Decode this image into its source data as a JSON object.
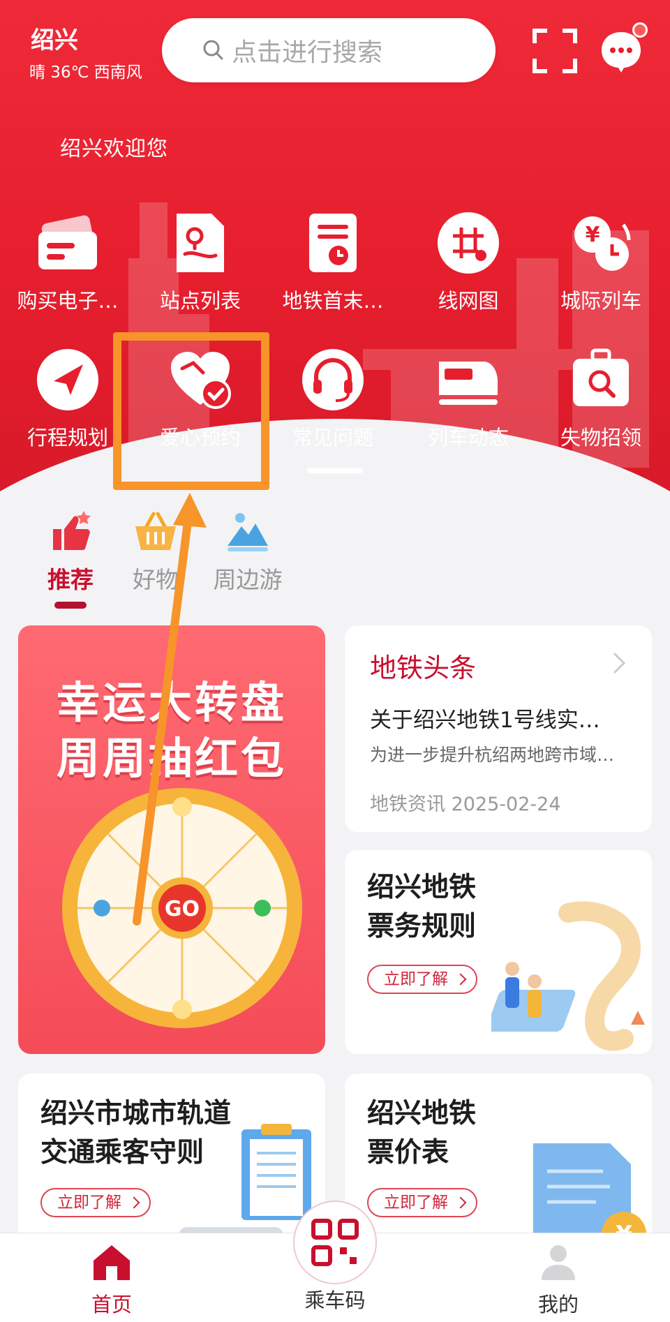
{
  "header": {
    "city": "绍兴",
    "weather": "晴 36℃ 西南风",
    "search_placeholder": "点击进行搜索",
    "welcome": "绍兴欢迎您"
  },
  "services": [
    {
      "label": "购买电子…",
      "icon": "ticket-card-icon"
    },
    {
      "label": "站点列表",
      "icon": "station-list-icon"
    },
    {
      "label": "地铁首末…",
      "icon": "first-last-train-icon"
    },
    {
      "label": "线网图",
      "icon": "network-map-icon"
    },
    {
      "label": "城际列车",
      "icon": "intercity-train-icon"
    },
    {
      "label": "行程规划",
      "icon": "route-plan-icon"
    },
    {
      "label": "爱心预约",
      "icon": "love-reservation-icon"
    },
    {
      "label": "常见问题",
      "icon": "faq-headset-icon"
    },
    {
      "label": "列车动态",
      "icon": "train-status-icon"
    },
    {
      "label": "失物招领",
      "icon": "lost-found-icon"
    }
  ],
  "tabs": [
    {
      "label": "推荐",
      "active": true
    },
    {
      "label": "好物",
      "active": false
    },
    {
      "label": "周边游",
      "active": false
    }
  ],
  "promo": {
    "line1": "幸运大转盘",
    "line2": "周周抽红包",
    "go": "GO"
  },
  "news": {
    "header": "地铁头条",
    "title": "关于绍兴地铁1号线实…",
    "subtitle": "为进一步提升杭绍两地跨市域…",
    "meta": "地铁资讯 2025-02-24"
  },
  "cards": {
    "rules": {
      "line1": "绍兴地铁",
      "line2": "票务规则",
      "button": "立即了解"
    },
    "guide": {
      "line1": "绍兴市城市轨道",
      "line2": "交通乘客守则",
      "button": "立即了解"
    },
    "price": {
      "line1": "绍兴地铁",
      "line2": "票价表",
      "button": "立即了解"
    }
  },
  "bottom_nav": [
    {
      "label": "首页",
      "active": true
    },
    {
      "label": "乘车码",
      "active": false
    },
    {
      "label": "我的",
      "active": false
    }
  ],
  "colors": {
    "brand_red": "#e61e2e",
    "active_red": "#c8102e",
    "highlight_orange": "#f7942a"
  }
}
